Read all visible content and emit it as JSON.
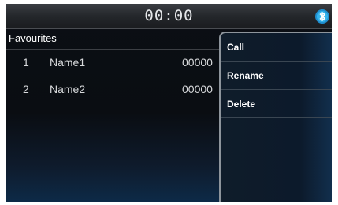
{
  "status": {
    "clock": "00:00",
    "bluetooth_icon": "bluetooth-icon"
  },
  "favourites": {
    "title": "Favourites",
    "items": [
      {
        "index": "1",
        "name": "Name1",
        "number": "00000"
      },
      {
        "index": "2",
        "name": "Name2",
        "number": "00000"
      }
    ]
  },
  "popup_menu": {
    "items": [
      {
        "label": "Call"
      },
      {
        "label": "Rename"
      },
      {
        "label": "Delete"
      }
    ]
  },
  "colors": {
    "background": "#0b0f14",
    "accent": "#2aa8e0",
    "text": "#ffffff"
  }
}
